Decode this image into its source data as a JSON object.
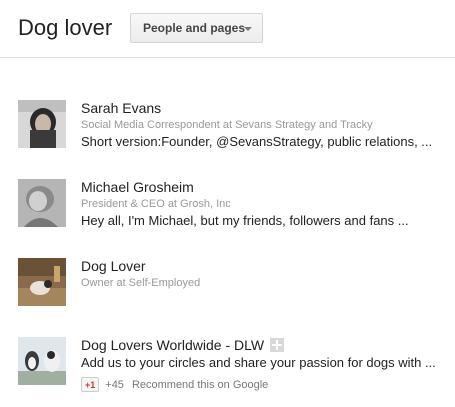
{
  "header": {
    "title": "Dog lover",
    "filter_label": "People and pages"
  },
  "results": [
    {
      "name": "Sarah Evans",
      "subtitle": "Social Media Correspondent at Sevans Strategy and Tracky",
      "snippet": "Short version:Founder, @SevansStrategy, public relations, ..."
    },
    {
      "name": "Michael Grosheim",
      "subtitle": "President & CEO at Grosh, Inc",
      "snippet": "Hey all, I'm Michael, but my friends, followers and fans ..."
    },
    {
      "name": "Dog Lover",
      "subtitle": "Owner at Self-Employed"
    },
    {
      "name": "Dog Lovers Worldwide - DLW",
      "snippet": "Add us to your circles and share your passion for dogs with ...",
      "plus_button": "+1",
      "plus_count": "+45",
      "recommend": "Recommend this on Google"
    }
  ]
}
